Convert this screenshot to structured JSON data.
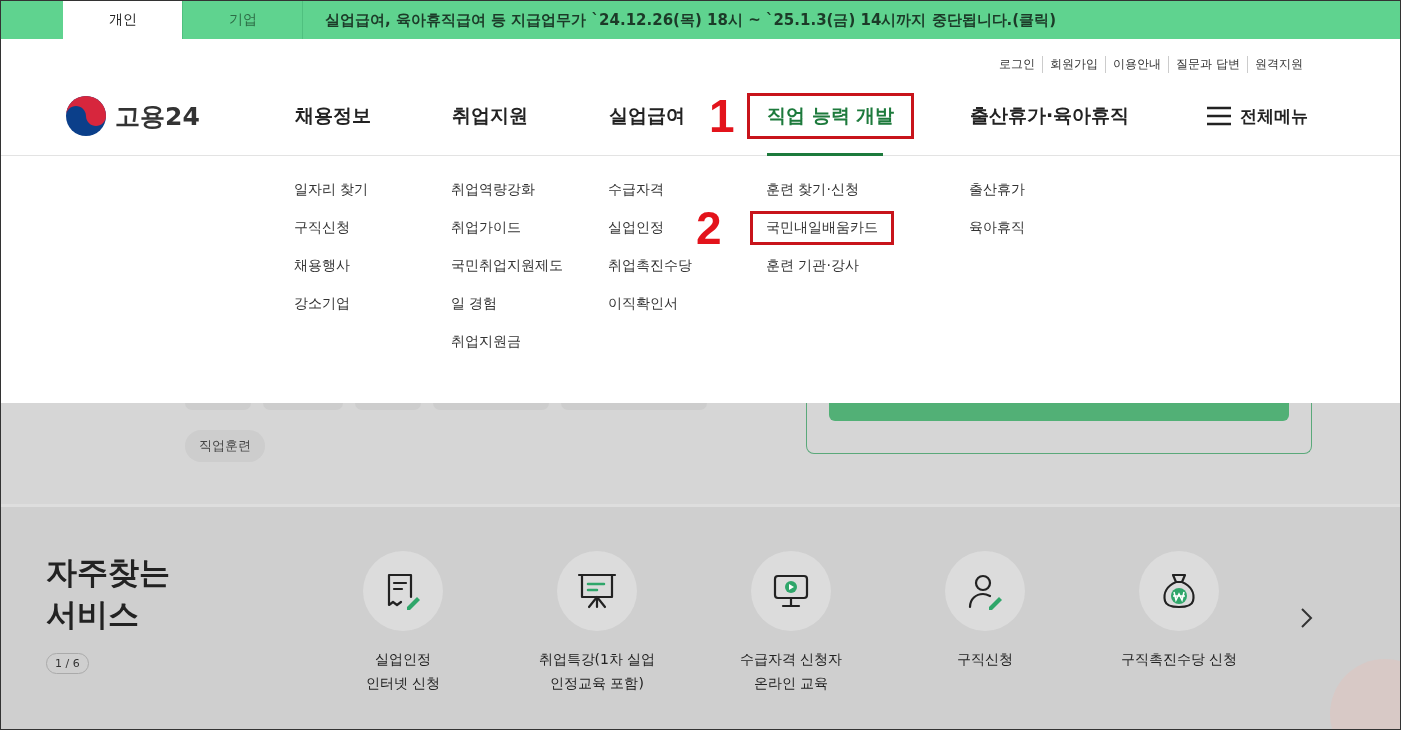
{
  "tabs": [
    {
      "label": "개인",
      "selected": true
    },
    {
      "label": "기업",
      "selected": false
    }
  ],
  "notice": "실업급여, 육아휴직급여 등 지급업무가 `24.12.26(목) 18시 ~ `25.1.3(금) 14시까지 중단됩니다.(클릭)",
  "utility_links": [
    "로그인",
    "회원가입",
    "이용안내",
    "질문과 답변",
    "원격지원"
  ],
  "logo": "고용24",
  "nav": [
    {
      "label": "채용정보",
      "selected": false,
      "highlighted": false,
      "submenu": [
        {
          "label": "일자리 찾기",
          "highlighted": false
        },
        {
          "label": "구직신청",
          "highlighted": false
        },
        {
          "label": "채용행사",
          "highlighted": false
        },
        {
          "label": "강소기업",
          "highlighted": false
        }
      ]
    },
    {
      "label": "취업지원",
      "selected": false,
      "highlighted": false,
      "submenu": [
        {
          "label": "취업역량강화",
          "highlighted": false
        },
        {
          "label": "취업가이드",
          "highlighted": false
        },
        {
          "label": "국민취업지원제도",
          "highlighted": false
        },
        {
          "label": "일 경험",
          "highlighted": false
        },
        {
          "label": "취업지원금",
          "highlighted": false
        }
      ]
    },
    {
      "label": "실업급여",
      "selected": false,
      "highlighted": false,
      "submenu": [
        {
          "label": "수급자격",
          "highlighted": false
        },
        {
          "label": "실업인정",
          "highlighted": false
        },
        {
          "label": "취업촉진수당",
          "highlighted": false
        },
        {
          "label": "이직확인서",
          "highlighted": false
        }
      ]
    },
    {
      "label": "직업 능력 개발",
      "selected": true,
      "highlighted": true,
      "annotation": "1",
      "submenu": [
        {
          "label": "훈련 찾기·신청",
          "highlighted": false
        },
        {
          "label": "국민내일배움카드",
          "highlighted": true,
          "annotation": "2"
        },
        {
          "label": "훈련 기관·강사",
          "highlighted": false
        }
      ]
    },
    {
      "label": "출산휴가·육아휴직",
      "selected": false,
      "highlighted": false,
      "submenu": [
        {
          "label": "출산휴가",
          "highlighted": false
        },
        {
          "label": "육아휴직",
          "highlighted": false
        }
      ]
    }
  ],
  "all_menu": "전체메뉴",
  "tags": [
    "직업훈련"
  ],
  "services": {
    "title": "자주찾는\n서비스",
    "pager": "1 / 6",
    "items": [
      {
        "kind": "receipt",
        "label": "실업인정\n인터넷 신청"
      },
      {
        "kind": "board",
        "label": "취업특강(1차 실업\n인정교육 포함)"
      },
      {
        "kind": "monitor",
        "label": "수급자격 신청자\n온라인 교육"
      },
      {
        "kind": "person",
        "label": "구직신청"
      },
      {
        "kind": "moneybag",
        "label": "구직촉진수당 신청"
      }
    ]
  }
}
